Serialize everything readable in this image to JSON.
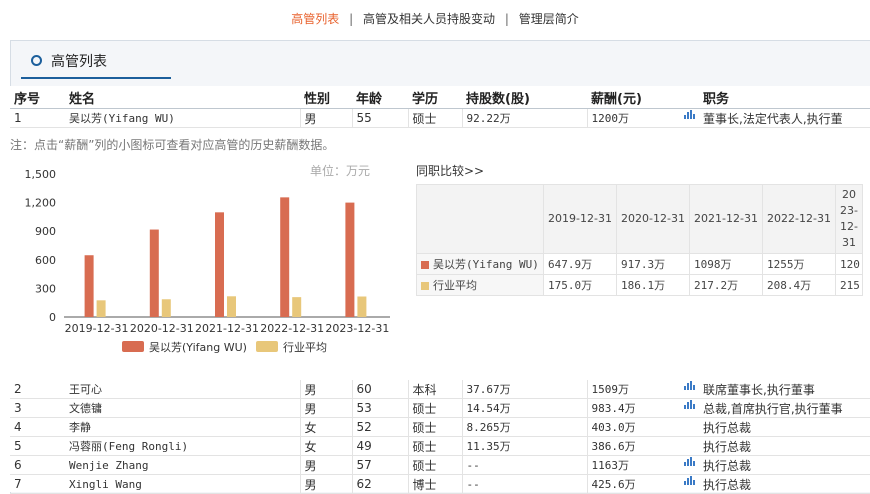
{
  "nav": {
    "items": [
      "高管列表",
      "高管及相关人员持股变动",
      "管理层简介"
    ],
    "separator": "|"
  },
  "section": {
    "title": "高管列表"
  },
  "table": {
    "headers": [
      "序号",
      "姓名",
      "性别",
      "年龄",
      "学历",
      "持股数(股)",
      "薪酬(元)",
      "职务"
    ],
    "rows": [
      {
        "no": "1",
        "name": "吴以芳(Yifang WU)",
        "gender": "男",
        "age": "55",
        "edu": "硕士",
        "shares": "92.22万",
        "pay": "1200万",
        "icon": true,
        "title": "董事长,法定代表人,执行董"
      },
      {
        "no": "2",
        "name": "王可心",
        "gender": "男",
        "age": "60",
        "edu": "本科",
        "shares": "37.67万",
        "pay": "1509万",
        "icon": true,
        "title": "联席董事长,执行董事"
      },
      {
        "no": "3",
        "name": "文德镛",
        "gender": "男",
        "age": "53",
        "edu": "硕士",
        "shares": "14.54万",
        "pay": "983.4万",
        "icon": true,
        "title": "总裁,首席执行官,执行董事"
      },
      {
        "no": "4",
        "name": "李静",
        "gender": "女",
        "age": "52",
        "edu": "硕士",
        "shares": "8.265万",
        "pay": "403.0万",
        "icon": false,
        "title": "执行总裁"
      },
      {
        "no": "5",
        "name": "冯蓉丽(Feng Rongli)",
        "gender": "女",
        "age": "49",
        "edu": "硕士",
        "shares": "11.35万",
        "pay": "386.6万",
        "icon": false,
        "title": "执行总裁"
      },
      {
        "no": "6",
        "name": "Wenjie Zhang",
        "gender": "男",
        "age": "57",
        "edu": "硕士",
        "shares": "--",
        "pay": "1163万",
        "icon": true,
        "title": "执行总裁"
      },
      {
        "no": "7",
        "name": "Xingli Wang",
        "gender": "男",
        "age": "62",
        "edu": "博士",
        "shares": "--",
        "pay": "425.6万",
        "icon": true,
        "title": "执行总裁"
      }
    ]
  },
  "note": "注：点击“薪酬”列的小图标可查看对应高管的历史薪酬数据。",
  "unit_label": "单位：万元",
  "compare": {
    "label": "同职比较>>",
    "headers": [
      "2019-12-31",
      "2020-12-31",
      "2021-12-31",
      "2022-12-31",
      "2023-12-31"
    ],
    "rows": [
      {
        "label": "吴以芳(Yifang WU)",
        "color": "#d86c51",
        "values": [
          "647.9万",
          "917.3万",
          "1098万",
          "1255万",
          "120"
        ]
      },
      {
        "label": "行业平均",
        "color": "#e8c77a",
        "values": [
          "175.0万",
          "186.1万",
          "217.2万",
          "208.4万",
          "215"
        ]
      }
    ]
  },
  "chart_data": {
    "type": "bar",
    "categories": [
      "2019-12-31",
      "2020-12-31",
      "2021-12-31",
      "2022-12-31",
      "2023-12-31"
    ],
    "series": [
      {
        "name": "吴以芳(Yifang WU)",
        "color": "#d86c51",
        "values": [
          647.9,
          917.3,
          1098,
          1255,
          1200
        ]
      },
      {
        "name": "行业平均",
        "color": "#e8c77a",
        "values": [
          175.0,
          186.1,
          217.2,
          208.4,
          215
        ]
      }
    ],
    "yticks": [
      "0",
      "300",
      "600",
      "900",
      "1,200",
      "1,500"
    ],
    "ylim": [
      0,
      1500
    ],
    "legend": "bottom"
  }
}
